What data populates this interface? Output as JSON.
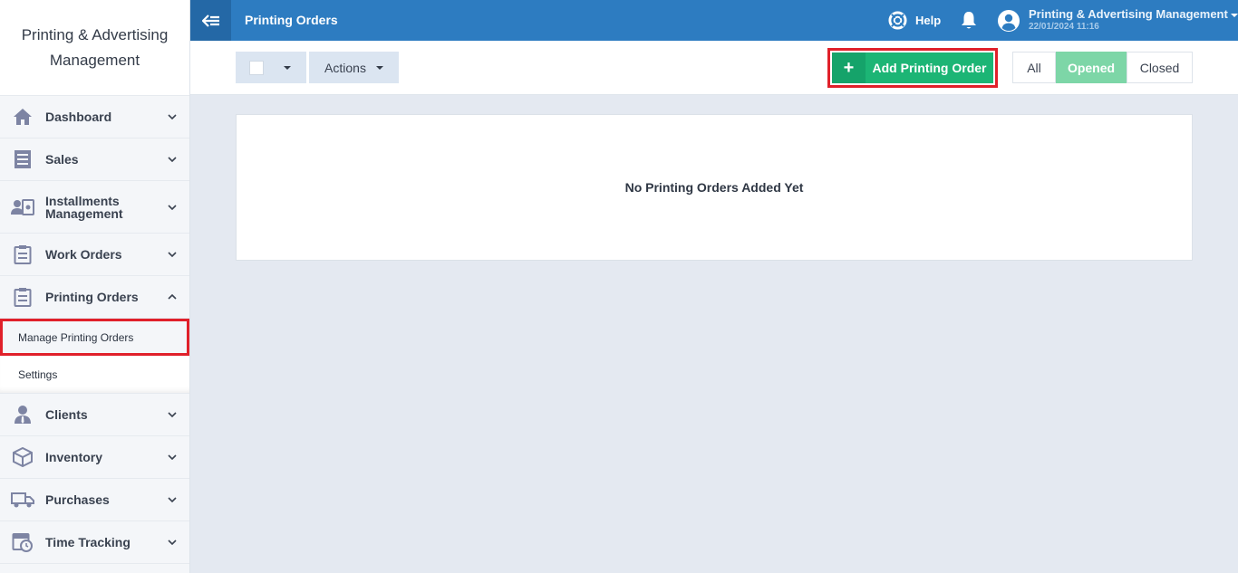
{
  "brand": {
    "title": "Printing & Advertising Management"
  },
  "sidebar": {
    "items": [
      {
        "label": "Dashboard",
        "icon": "home-icon"
      },
      {
        "label": "Sales",
        "icon": "receipt-icon"
      },
      {
        "label": "Installments Management",
        "icon": "installments-icon"
      },
      {
        "label": "Work Orders",
        "icon": "clipboard-icon"
      },
      {
        "label": "Printing Orders",
        "icon": "clipboard-icon",
        "expanded": true
      },
      {
        "label": "Clients",
        "icon": "client-icon"
      },
      {
        "label": "Inventory",
        "icon": "box-icon"
      },
      {
        "label": "Purchases",
        "icon": "truck-icon"
      },
      {
        "label": "Time Tracking",
        "icon": "calendar-clock-icon"
      }
    ],
    "submenu": [
      {
        "label": "Manage Printing Orders",
        "active": true
      },
      {
        "label": "Settings"
      }
    ]
  },
  "topbar": {
    "title": "Printing Orders",
    "help_label": "Help",
    "user_name": "Printing & Advertising Management",
    "user_date": "22/01/2024 11:16"
  },
  "toolbar": {
    "actions_label": "Actions",
    "add_label": "Add Printing Order",
    "add_symbol": "+",
    "filters": [
      "All",
      "Opened",
      "Closed"
    ],
    "active_filter": "Opened"
  },
  "main": {
    "empty_message": "No Printing Orders Added Yet"
  },
  "colors": {
    "topbar": "#2d7cc1",
    "add_button": "#1cb575",
    "active_filter": "#7dd6a7",
    "highlight_border": "#e0202a",
    "sidebar_icon": "#7d84a3"
  }
}
